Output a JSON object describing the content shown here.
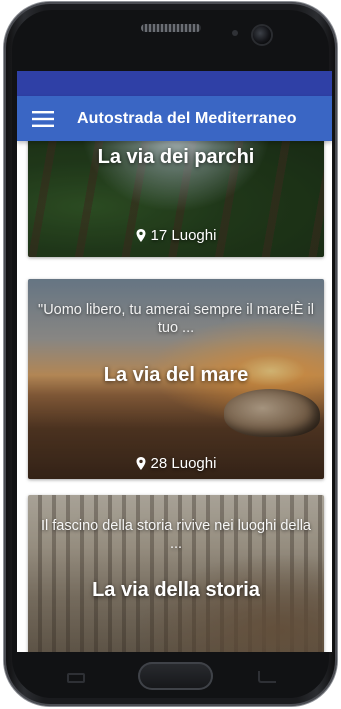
{
  "app": {
    "title": "Autostrada del Mediterraneo",
    "menu_icon": "hamburger-menu-icon"
  },
  "colors": {
    "status_bar": "#2f40a6",
    "app_bar": "#3a66c4"
  },
  "cards": [
    {
      "title": "La via dei parchi",
      "description": "",
      "count": "17 Luoghi",
      "image": "forest-trees"
    },
    {
      "title": "La via del mare",
      "description": "\"Uomo libero, tu amerai sempre il mare!È il tuo ...",
      "count": "28 Luoghi",
      "image": "sea-shell-sunset"
    },
    {
      "title": "La via della storia",
      "description": "Il fascino della storia rivive nei luoghi della ...",
      "count": "",
      "image": "historic-photo"
    }
  ]
}
